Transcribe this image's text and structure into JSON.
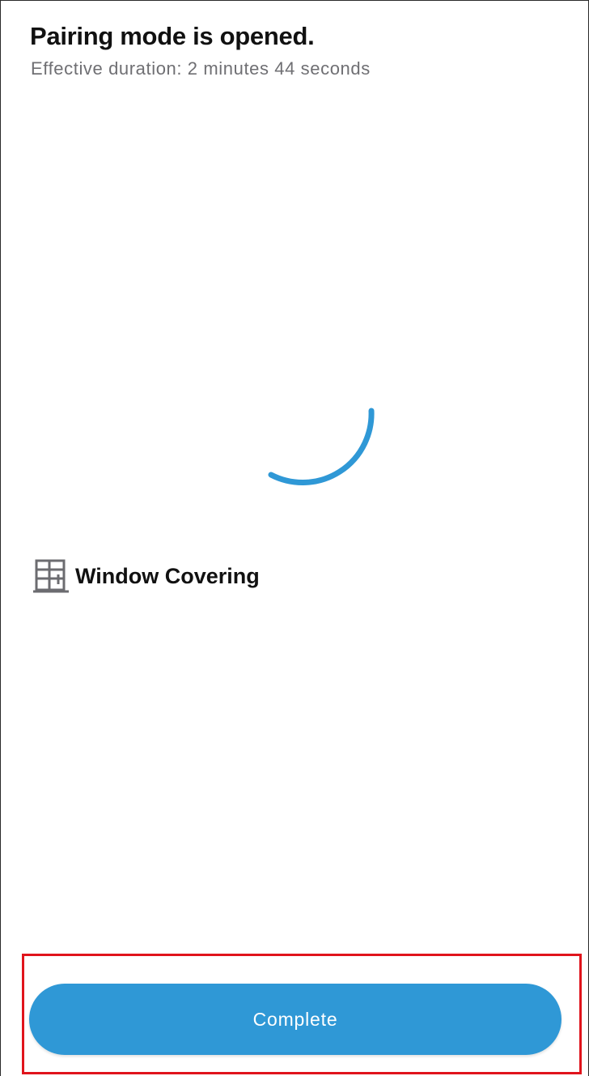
{
  "header": {
    "title": "Pairing mode is opened.",
    "subtitle": "Effective duration: 2 minutes 44 seconds"
  },
  "device": {
    "icon": "window-covering-icon",
    "label": "Window Covering"
  },
  "footer": {
    "complete_label": "Complete"
  },
  "colors": {
    "accent": "#2f98d6",
    "highlight": "#e0141c",
    "title": "#111111",
    "subtitle": "#6f6f73"
  }
}
